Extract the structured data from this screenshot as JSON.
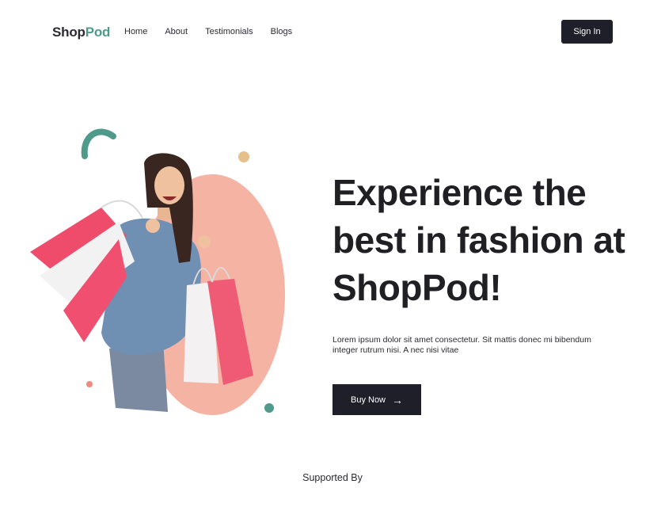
{
  "nav": {
    "logo": {
      "part1": "Shop",
      "part2": "Pod"
    },
    "links": [
      "Home",
      "About",
      "Testimonials",
      "Blogs"
    ],
    "signin_label": "Sign In"
  },
  "hero": {
    "headline_lines": [
      "Experience the",
      "best in fashion at",
      "ShopPod!"
    ],
    "description": "Lorem ipsum dolor sit amet consectetur. Sit mattis donec mi bibendum integer rutrum nisi. A nec nisi vitae",
    "button_label": "Buy Now",
    "button_icon": "arrow-right-icon",
    "image": "smiling woman holding shopping bags"
  },
  "supported_by": "Supported By",
  "colors": {
    "accent_teal": "#4f9a8b",
    "dark": "#1f1f29",
    "peach": "#f5b3a4",
    "sand": "#e6c08a",
    "coral": "#ef8a7f"
  }
}
